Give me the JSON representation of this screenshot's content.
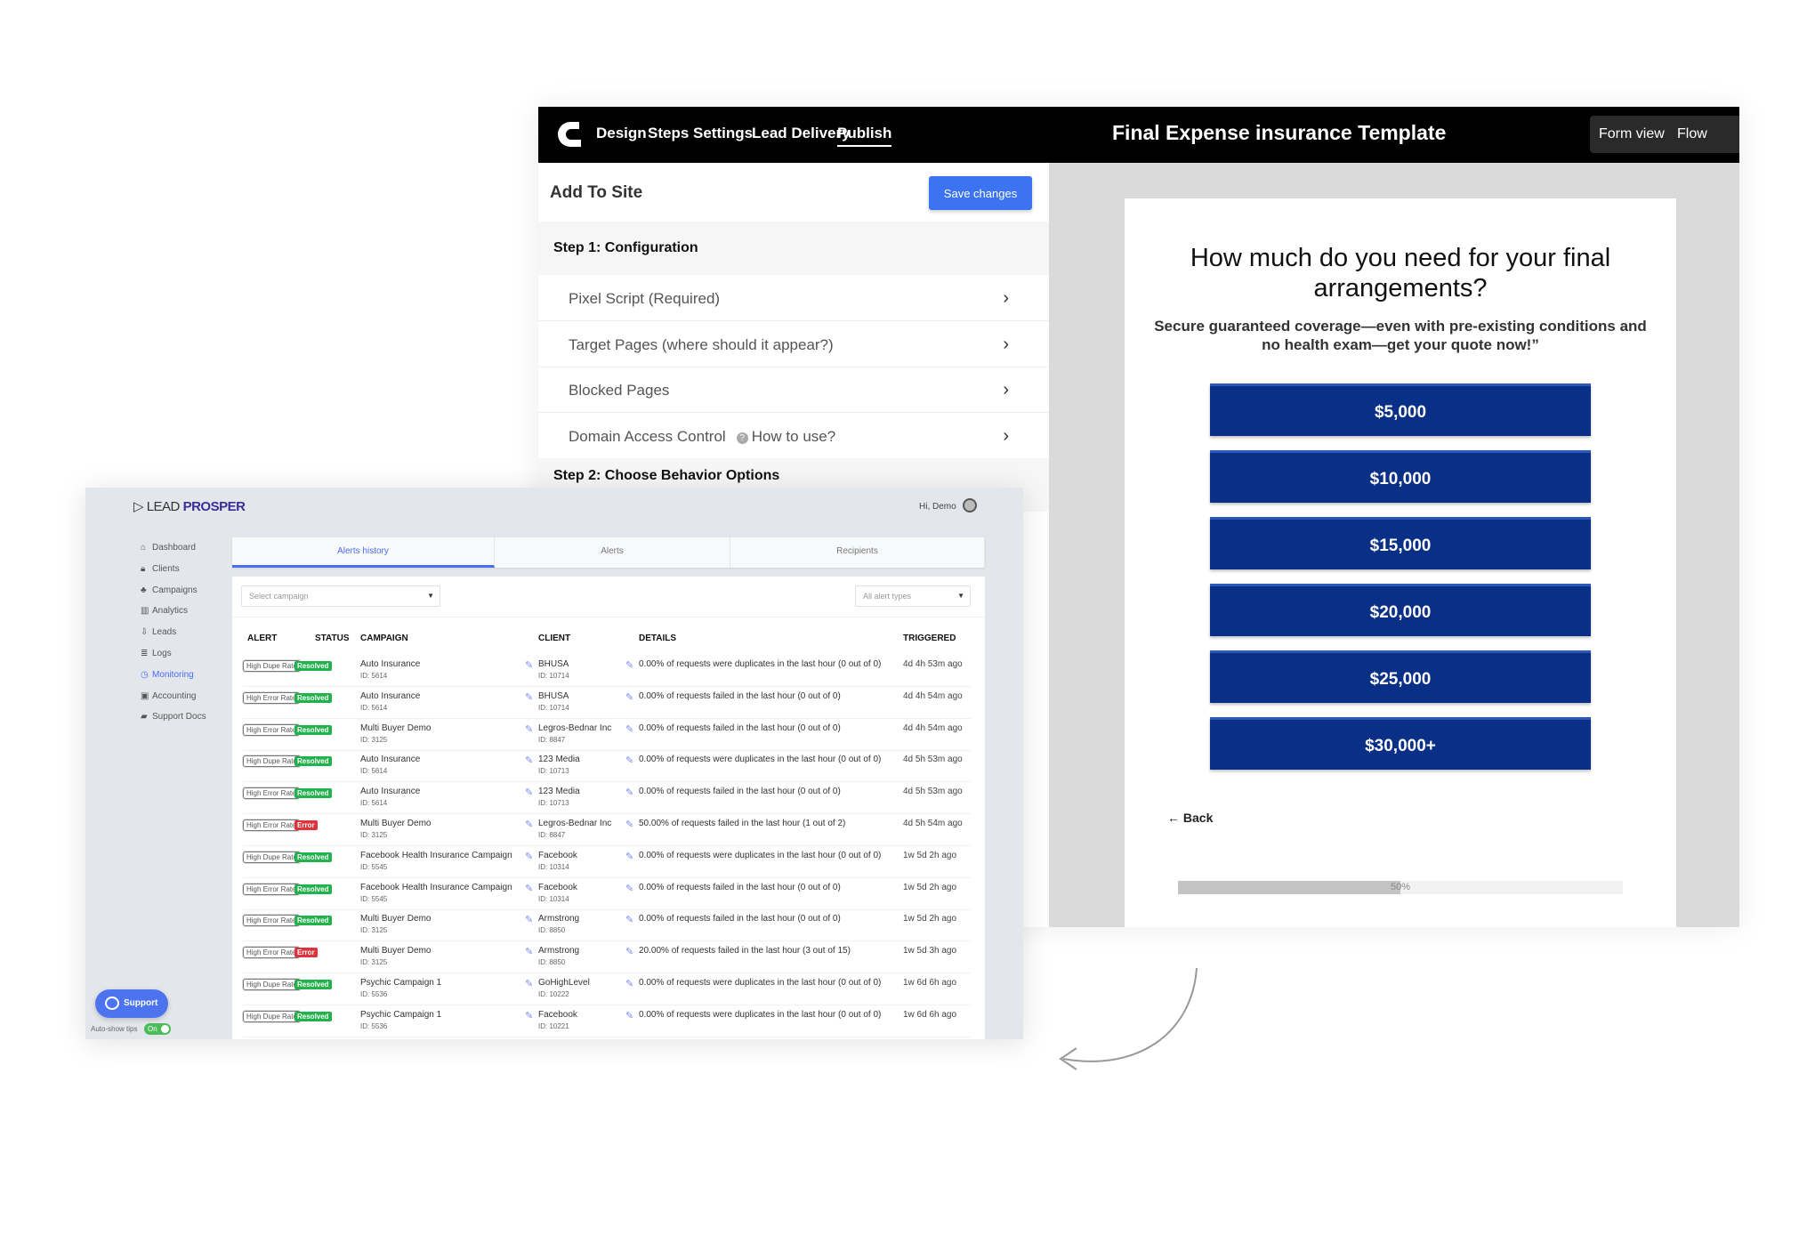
{
  "builder": {
    "nav": [
      "Design",
      "Steps",
      "Settings",
      "Lead Delivery",
      "Publish"
    ],
    "active_nav": "Publish",
    "title": "Final Expense insurance Template",
    "views": [
      "Form view",
      "Flow view"
    ],
    "panel_title": "Add To Site",
    "save_label": "Save changes",
    "step1": "Step 1: Configuration",
    "config_items": [
      "Pixel Script (Required)",
      "Target Pages (where should it appear?)",
      "Blocked Pages",
      "Domain Access Control"
    ],
    "how_to_use": "How to use?",
    "step2": "Step 2: Choose Behavior Options"
  },
  "preview": {
    "question": "How much do you need for your final arrangements?",
    "subtitle": "Secure guaranteed coverage—even with pre-existing conditions and no health exam—get your quote now!”",
    "options": [
      "$5,000",
      "$10,000",
      "$15,000",
      "$20,000",
      "$25,000",
      "$30,000+"
    ],
    "option_color": "#0a2f86",
    "back_label": "← Back",
    "progress_percent": 50,
    "progress_label": "50%"
  },
  "leadprosper": {
    "logo": "LEAD PROSPER",
    "greeting": "Hi, Demo",
    "sidebar": [
      {
        "label": "Dashboard",
        "icon": "dashboard-icon"
      },
      {
        "label": "Clients",
        "icon": "lock-icon"
      },
      {
        "label": "Campaigns",
        "icon": "campaigns-icon"
      },
      {
        "label": "Analytics",
        "icon": "chart-icon"
      },
      {
        "label": "Leads",
        "icon": "download-icon"
      },
      {
        "label": "Logs",
        "icon": "list-icon"
      },
      {
        "label": "Monitoring",
        "icon": "clock-icon",
        "active": true
      },
      {
        "label": "Accounting",
        "icon": "money-icon"
      },
      {
        "label": "Support Docs",
        "icon": "book-icon"
      }
    ],
    "tabs": [
      "Alerts history",
      "Alerts",
      "Recipients"
    ],
    "campaign_placeholder": "Select campaign",
    "alert_types": "All alert types",
    "columns": [
      "ALERT",
      "STATUS",
      "CAMPAIGN",
      "CLIENT",
      "DETAILS",
      "TRIGGERED"
    ],
    "rows": [
      {
        "alert": "High Dupe Rate",
        "status": "Resolved",
        "campaign": "Auto Insurance",
        "campaign_id": "ID: 5614",
        "client": "BHUSA",
        "client_id": "ID: 10714",
        "details": "0.00% of requests were duplicates in the last hour (0 out of 0)",
        "triggered": "4d 4h 53m ago"
      },
      {
        "alert": "High Error Rate",
        "status": "Resolved",
        "campaign": "Auto Insurance",
        "campaign_id": "ID: 5614",
        "client": "BHUSA",
        "client_id": "ID: 10714",
        "details": "0.00% of requests failed in the last hour (0 out of 0)",
        "triggered": "4d 4h 54m ago"
      },
      {
        "alert": "High Error Rate",
        "status": "Resolved",
        "campaign": "Multi Buyer Demo",
        "campaign_id": "ID: 3125",
        "client": "Legros-Bednar Inc",
        "client_id": "ID: 8847",
        "details": "0.00% of requests failed in the last hour (0 out of 0)",
        "triggered": "4d 4h 54m ago"
      },
      {
        "alert": "High Dupe Rate",
        "status": "Resolved",
        "campaign": "Auto Insurance",
        "campaign_id": "ID: 5614",
        "client": "123 Media",
        "client_id": "ID: 10713",
        "details": "0.00% of requests were duplicates in the last hour (0 out of 0)",
        "triggered": "4d 5h 53m ago"
      },
      {
        "alert": "High Error Rate",
        "status": "Resolved",
        "campaign": "Auto Insurance",
        "campaign_id": "ID: 5614",
        "client": "123 Media",
        "client_id": "ID: 10713",
        "details": "0.00% of requests failed in the last hour (0 out of 0)",
        "triggered": "4d 5h 53m ago"
      },
      {
        "alert": "High Error Rate",
        "status": "Error",
        "campaign": "Multi Buyer Demo",
        "campaign_id": "ID: 3125",
        "client": "Legros-Bednar Inc",
        "client_id": "ID: 8847",
        "details": "50.00% of requests failed in the last hour (1 out of 2)",
        "triggered": "4d 5h 54m ago"
      },
      {
        "alert": "High Dupe Rate",
        "status": "Resolved",
        "campaign": "Facebook Health Insurance Campaign",
        "campaign_id": "ID: 5545",
        "client": "Facebook",
        "client_id": "ID: 10314",
        "details": "0.00% of requests were duplicates in the last hour (0 out of 0)",
        "triggered": "1w 5d 2h ago"
      },
      {
        "alert": "High Error Rate",
        "status": "Resolved",
        "campaign": "Facebook Health Insurance Campaign",
        "campaign_id": "ID: 5545",
        "client": "Facebook",
        "client_id": "ID: 10314",
        "details": "0.00% of requests failed in the last hour (0 out of 0)",
        "triggered": "1w 5d 2h ago"
      },
      {
        "alert": "High Error Rate",
        "status": "Resolved",
        "campaign": "Multi Buyer Demo",
        "campaign_id": "ID: 3125",
        "client": "Armstrong",
        "client_id": "ID: 8850",
        "details": "0.00% of requests failed in the last hour (0 out of 0)",
        "triggered": "1w 5d 2h ago"
      },
      {
        "alert": "High Error Rate",
        "status": "Error",
        "campaign": "Multi Buyer Demo",
        "campaign_id": "ID: 3125",
        "client": "Armstrong",
        "client_id": "ID: 8850",
        "details": "20.00% of requests failed in the last hour (3 out of 15)",
        "triggered": "1w 5d 3h ago"
      },
      {
        "alert": "High Dupe Rate",
        "status": "Resolved",
        "campaign": "Psychic Campaign 1",
        "campaign_id": "ID: 5536",
        "client": "GoHighLevel",
        "client_id": "ID: 10222",
        "details": "0.00% of requests were duplicates in the last hour (0 out of 0)",
        "triggered": "1w 6d 6h ago"
      },
      {
        "alert": "High Dupe Rate",
        "status": "Resolved",
        "campaign": "Psychic Campaign 1",
        "campaign_id": "ID: 5536",
        "client": "Facebook",
        "client_id": "ID: 10221",
        "details": "0.00% of requests were duplicates in the last hour (0 out of 0)",
        "triggered": "1w 6d 6h ago"
      }
    ],
    "status_colors": {
      "Resolved": "#22b24c",
      "Error": "#e0323c"
    },
    "support_label": "Support",
    "tips_label": "Auto-show tips",
    "toggle_label": "On"
  }
}
